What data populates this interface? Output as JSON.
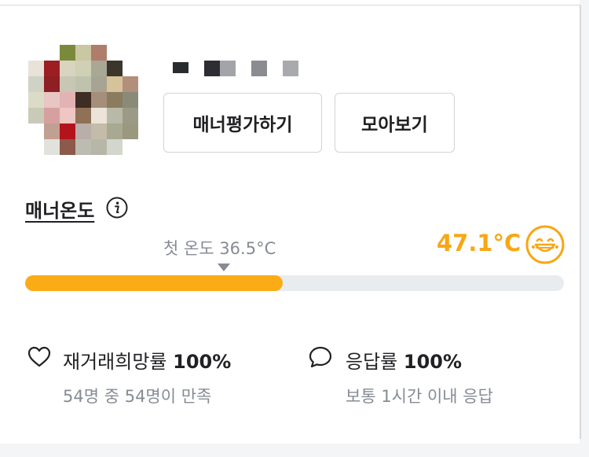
{
  "profile": {
    "avatar_alt": "profile photo (pixelated)",
    "buttons": {
      "rate_manner": "매너평가하기",
      "view_all": "모아보기"
    }
  },
  "manner": {
    "title": "매너온도",
    "first_temperature_label": "첫 온도 36.5°C",
    "temperature": "47.1°C",
    "temperature_value": 47.1,
    "temperature_fraction": 0.478,
    "accent_color": "#f7a715",
    "face_icon": "smiling-face-icon"
  },
  "stats": {
    "rebuy": {
      "label": "재거래희망률",
      "value": "100%",
      "sub": "54명 중 54명이 만족",
      "icon": "heart-outline-icon"
    },
    "response": {
      "label": "응답률",
      "value": "100%",
      "sub": "보통 1시간 이내 응답",
      "icon": "chat-bubble-icon"
    }
  }
}
